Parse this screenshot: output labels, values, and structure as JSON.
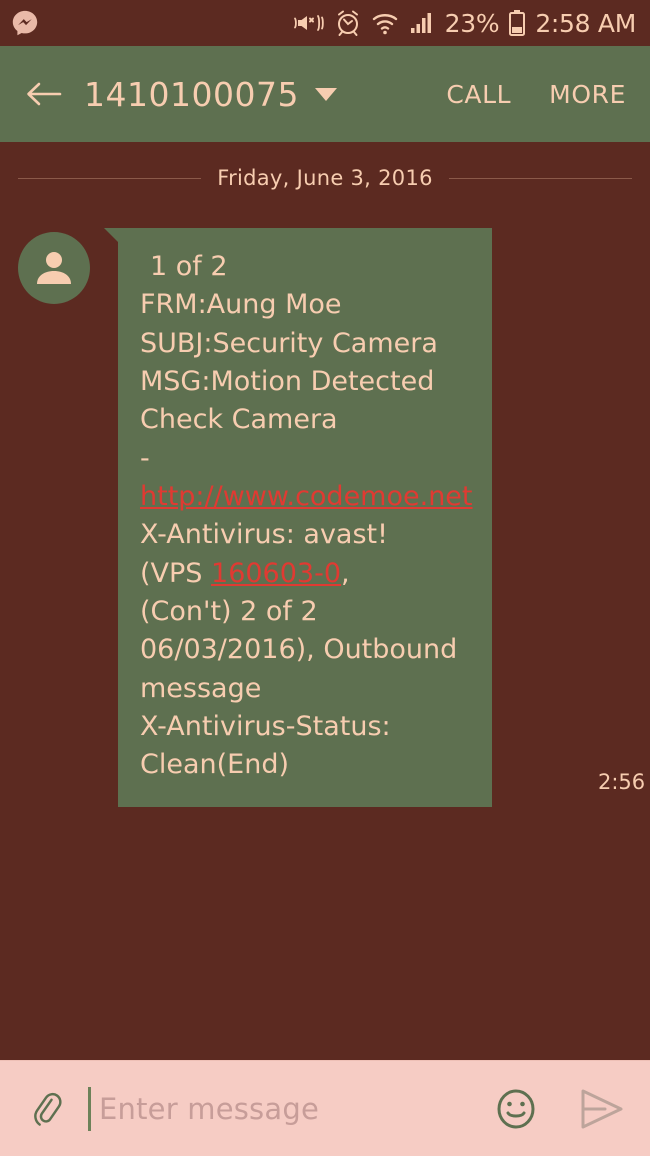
{
  "status_bar": {
    "notification_icon": "messenger-icon",
    "icons": [
      "mute-vibrate-icon",
      "alarm-clock-icon",
      "wifi-icon",
      "cellular-signal-icon"
    ],
    "battery_percent": "23%",
    "battery_icon": "battery-icon",
    "time": "2:58 AM"
  },
  "header": {
    "back_icon": "back-arrow-icon",
    "title": "1410100075",
    "dropdown_icon": "chevron-down-icon",
    "call_label": "CALL",
    "more_label": "MORE"
  },
  "conversation": {
    "date_divider": "Friday, June 3, 2016",
    "message": {
      "avatar_icon": "person-avatar-icon",
      "line_1": "1 of 2",
      "line_2": "FRM:Aung Moe",
      "line_3": "SUBJ:Security Camera",
      "line_4": "MSG:Motion Detected",
      "line_5": "Check Camera",
      "line_6_prefix": "- ",
      "link_url": "http://www.codemoe.net",
      "line_7": "X-Antivirus: avast!",
      "line_8_prefix": "(VPS ",
      "link_vps": "160603-0",
      "line_8_suffix": ",",
      "line_9": "(Con't) 2 of 2",
      "line_10": "06/03/2016), Outbound",
      "line_11": "message",
      "line_12": "X-Antivirus-Status:",
      "line_13": "Clean(End)",
      "timestamp": "2:56 AM"
    }
  },
  "input_bar": {
    "attach_icon": "paperclip-icon",
    "placeholder": "Enter message",
    "value": "",
    "emoji_icon": "smiley-icon",
    "send_icon": "send-arrow-icon"
  },
  "colors": {
    "background": "#5c2a21",
    "accent_green": "#5e7050",
    "text_peach": "#f7cdb0",
    "link_red": "#e03a32",
    "input_bar_pink": "#f6ccc4"
  }
}
